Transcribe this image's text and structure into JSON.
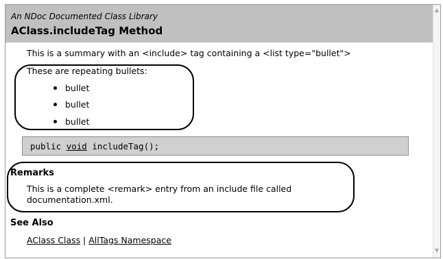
{
  "header": {
    "library": "An NDoc Documented Class Library",
    "title": "AClass.includeTag Method"
  },
  "summary": "This is a summary with an <include> tag containing a <list type=\"bullet\">",
  "list_intro": "These are repeating bullets:",
  "bullets": [
    "bullet",
    "bullet",
    "bullet"
  ],
  "syntax": {
    "prefix": "public ",
    "type": "void",
    "suffix": " includeTag();"
  },
  "remarks": {
    "heading": "Remarks",
    "line1": "This is a complete <remark> entry from an include file called",
    "line2": "documentation.xml."
  },
  "see_also": {
    "heading": "See Also",
    "link1": "AClass Class",
    "separator": " | ",
    "link2": "AllTags Namespace"
  },
  "icons": {
    "scroll_up": "chevron-up-icon",
    "scroll_down": "chevron-down-icon"
  }
}
